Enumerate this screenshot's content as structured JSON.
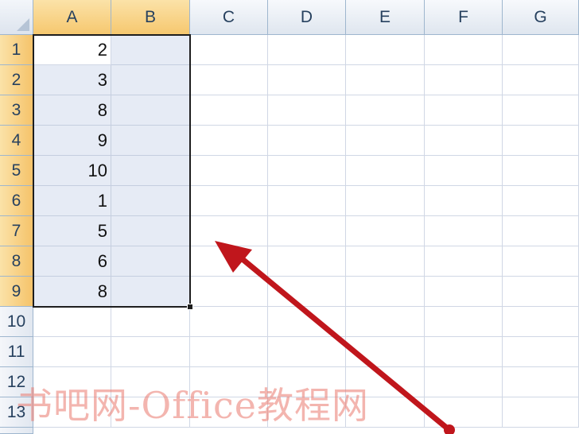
{
  "columns": [
    "A",
    "B",
    "C",
    "D",
    "E",
    "F",
    "G"
  ],
  "rows": [
    "1",
    "2",
    "3",
    "4",
    "5",
    "6",
    "7",
    "8",
    "9",
    "10",
    "11",
    "12",
    "13"
  ],
  "column_a_values": [
    "2",
    "3",
    "8",
    "9",
    "10",
    "1",
    "5",
    "6",
    "8"
  ],
  "selected_range": "A1:B9",
  "watermark": "书吧网-Office教程网",
  "colors": {
    "selected_header": "#f6c86f",
    "range_fill": "#e6ebf5",
    "arrow": "#c0161c"
  }
}
